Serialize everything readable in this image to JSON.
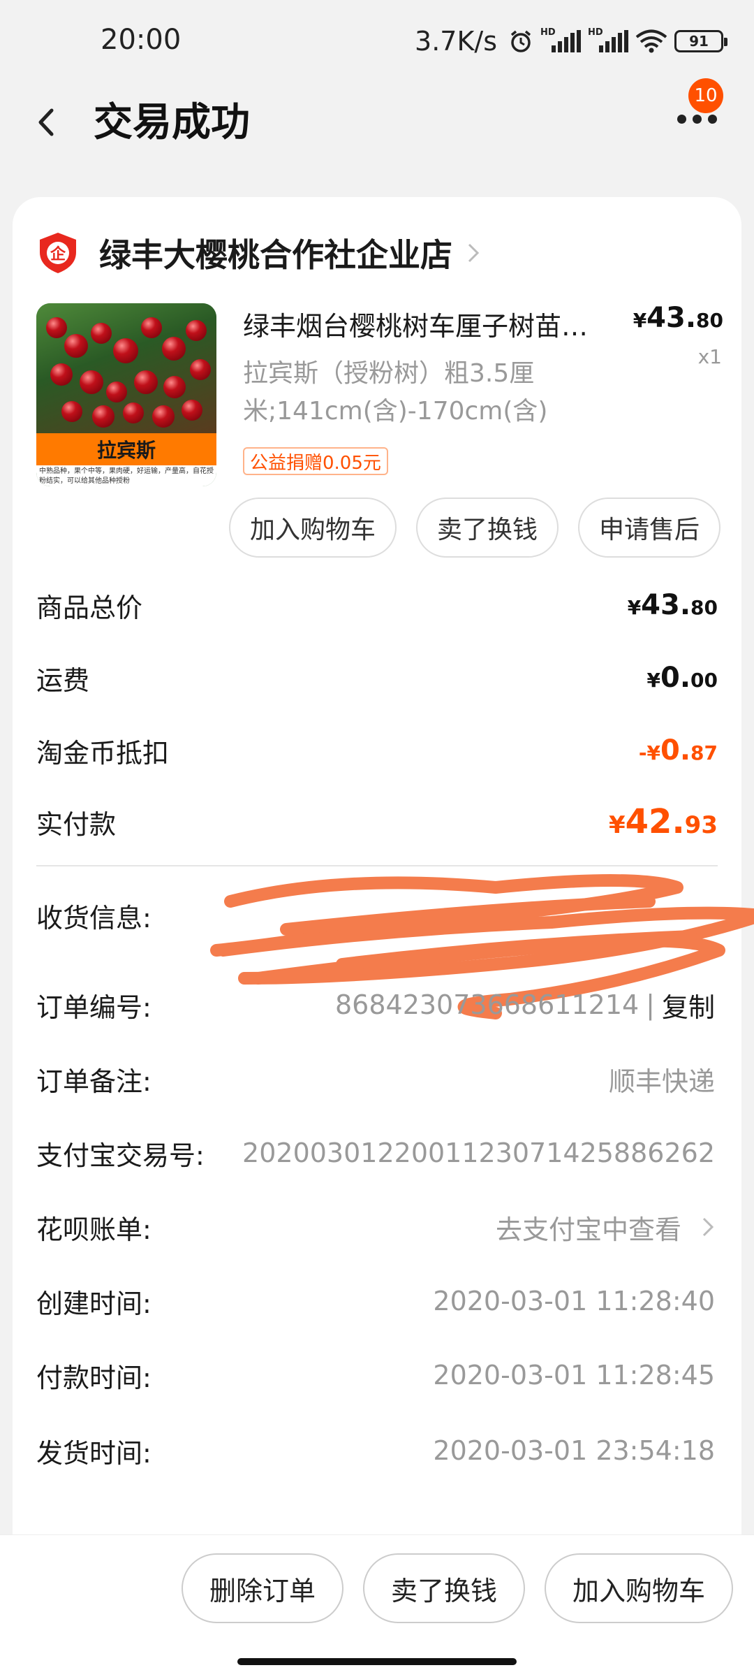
{
  "status_bar": {
    "time": "20:00",
    "net_speed": "3.7K/s",
    "battery": "91",
    "icons": [
      "alarm-icon",
      "signal-hd-icon",
      "signal-hd-icon",
      "wifi-icon",
      "battery-icon"
    ]
  },
  "header": {
    "title": "交易成功",
    "badge_count": "10"
  },
  "shop": {
    "name": "绿丰大樱桃合作社企业店"
  },
  "product": {
    "image_label": "拉宾斯",
    "image_caption": "中熟品种，果个中等，果肉硬，好运输，产量高，自花授粉结实，可以给其他品种授粉",
    "title": "绿丰烟台樱桃树车厘子树苗…",
    "spec": "拉宾斯（授粉树）粗3.5厘米;141cm(含)-170cm(含)",
    "charity": "公益捐赠0.05元",
    "price_yen": "¥",
    "price_int": "43.",
    "price_dec": "80",
    "qty": "x1",
    "buttons": [
      "加入购物车",
      "卖了换钱",
      "申请售后"
    ]
  },
  "summary": [
    {
      "label": "商品总价",
      "yen": "¥",
      "int": "43.",
      "dec": "80"
    },
    {
      "label": "运费",
      "yen": "¥",
      "int": "0.",
      "dec": "00"
    },
    {
      "label": "淘金币抵扣",
      "yen": "-¥",
      "int": "0.",
      "dec": "87"
    },
    {
      "label": "实付款",
      "yen": "¥",
      "int": "42.",
      "dec": "93"
    }
  ],
  "order_info": {
    "shipping_label": "收货信息:",
    "order_no_label": "订单编号:",
    "order_no": "868423073668611214",
    "copy_sep": "|",
    "copy": "复制",
    "note_label": "订单备注:",
    "note": "顺丰快递",
    "alipay_label": "支付宝交易号:",
    "alipay_no": "2020030122001123071425886262",
    "huabei_label": "花呗账单:",
    "huabei_link": "去支付宝中查看",
    "created_label": "创建时间:",
    "created": "2020-03-01 11:28:40",
    "paid_label": "付款时间:",
    "paid": "2020-03-01 11:28:45",
    "shipped_label": "发货时间:",
    "shipped": "2020-03-01 23:54:18"
  },
  "bottom": {
    "buttons": [
      "删除订单",
      "卖了换钱",
      "加入购物车"
    ]
  },
  "colors": {
    "accent": "#ff5000",
    "background": "#f2f2f2",
    "scribble": "#f47c4c"
  }
}
